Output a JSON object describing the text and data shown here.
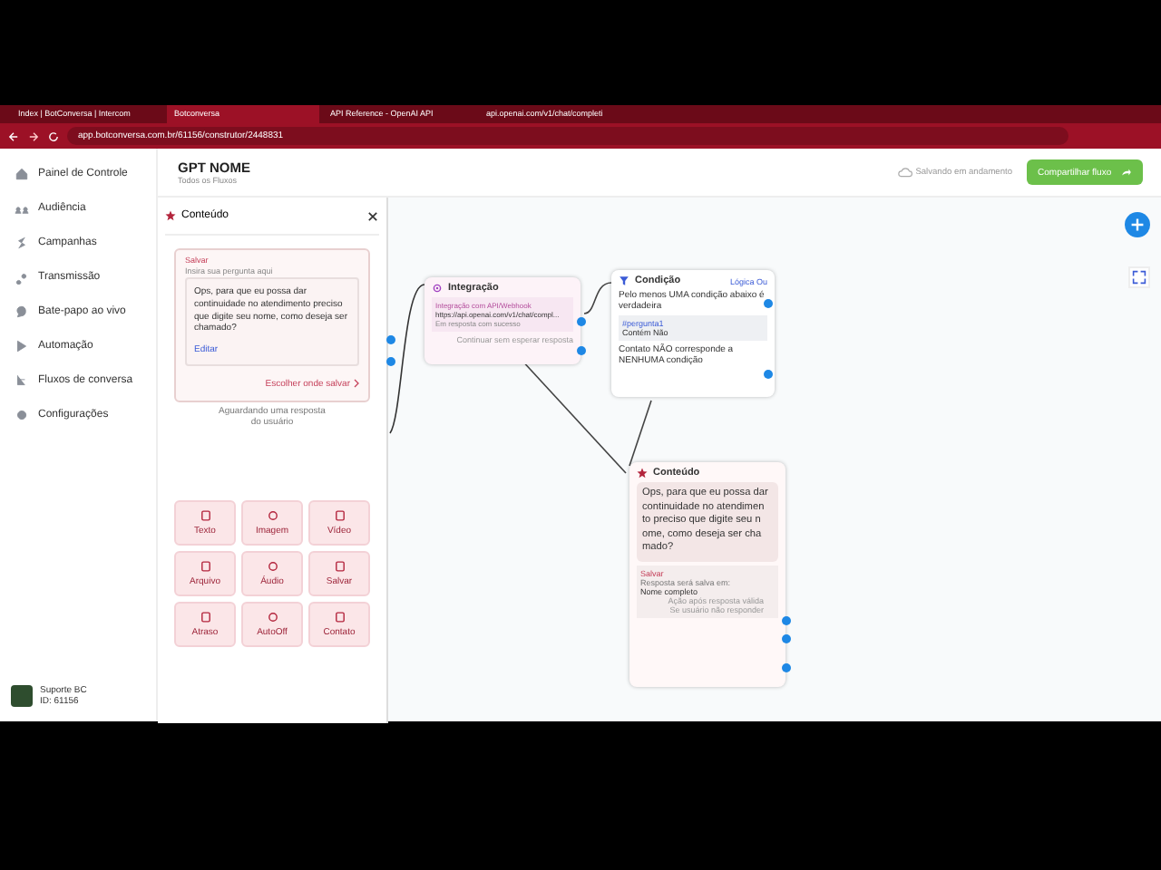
{
  "browser": {
    "tabs": [
      {
        "title": "Index | BotConversa | Intercom",
        "selected": false
      },
      {
        "title": "Botconversa",
        "selected": true
      },
      {
        "title": "API Reference - OpenAI API",
        "selected": false
      },
      {
        "title": "api.openai.com/v1/chat/completi",
        "selected": false
      }
    ],
    "url": "app.botconversa.com.br/61156/construtor/2448831"
  },
  "sidebar": {
    "items": [
      {
        "label": "Painel de Controle"
      },
      {
        "label": "Audiência"
      },
      {
        "label": "Campanhas"
      },
      {
        "label": "Transmissão"
      },
      {
        "label": "Bate-papo ao vivo"
      },
      {
        "label": "Automação"
      },
      {
        "label": "Fluxos de conversa"
      },
      {
        "label": "Configurações"
      }
    ],
    "user": {
      "name": "Suporte BC",
      "id": "ID: 61156"
    }
  },
  "header": {
    "title": "GPT NOME",
    "subtitle": "Todos os Fluxos",
    "save_status": "Salvando em andamento",
    "share_button": "Compartilhar fluxo"
  },
  "panel": {
    "title": "Conteúdo",
    "save_label": "Salvar",
    "hint": "Insira sua pergunta aqui",
    "message": "Ops, para que eu possa dar continuidade no atendimento preciso que digite seu nome, como deseja ser chamado?",
    "edit_link": "Editar",
    "choose_save": "Escolher onde salvar",
    "waiting": "Aguardando uma resposta do usuário",
    "buttons": [
      {
        "label": "Texto"
      },
      {
        "label": "Imagem"
      },
      {
        "label": "Vídeo"
      },
      {
        "label": "Arquivo"
      },
      {
        "label": "Áudio"
      },
      {
        "label": "Salvar"
      },
      {
        "label": "Atraso"
      },
      {
        "label": "AutoOff"
      },
      {
        "label": "Contato"
      }
    ]
  },
  "nodes": {
    "integration": {
      "title": "Integração",
      "label": "Integração com API/Webhook",
      "url": "https://api.openai.com/v1/chat/compl...",
      "note": "Em resposta com sucesso",
      "continue": "Continuar sem esperar resposta"
    },
    "condition": {
      "title": "Condição",
      "logic": "Lógica Ou",
      "text": "Pelo menos UMA condição abaixo é verdadeira",
      "variable": "#pergunta1",
      "contains": "Contém",
      "contains_value": "Não",
      "fallback": "Contato NÃO corresponde a NENHUMA condição"
    },
    "content": {
      "title": "Conteúdo",
      "message": "Ops, para que eu possa dar continuidade no atendimen to preciso que digite seu n ome, como deseja ser cha mado?",
      "save_label": "Salvar",
      "save_hint": "Resposta será salva em:",
      "save_field": "Nome completo",
      "valid_action": "Ação após resposta válida",
      "no_reply": "Se usuário não responder"
    }
  }
}
